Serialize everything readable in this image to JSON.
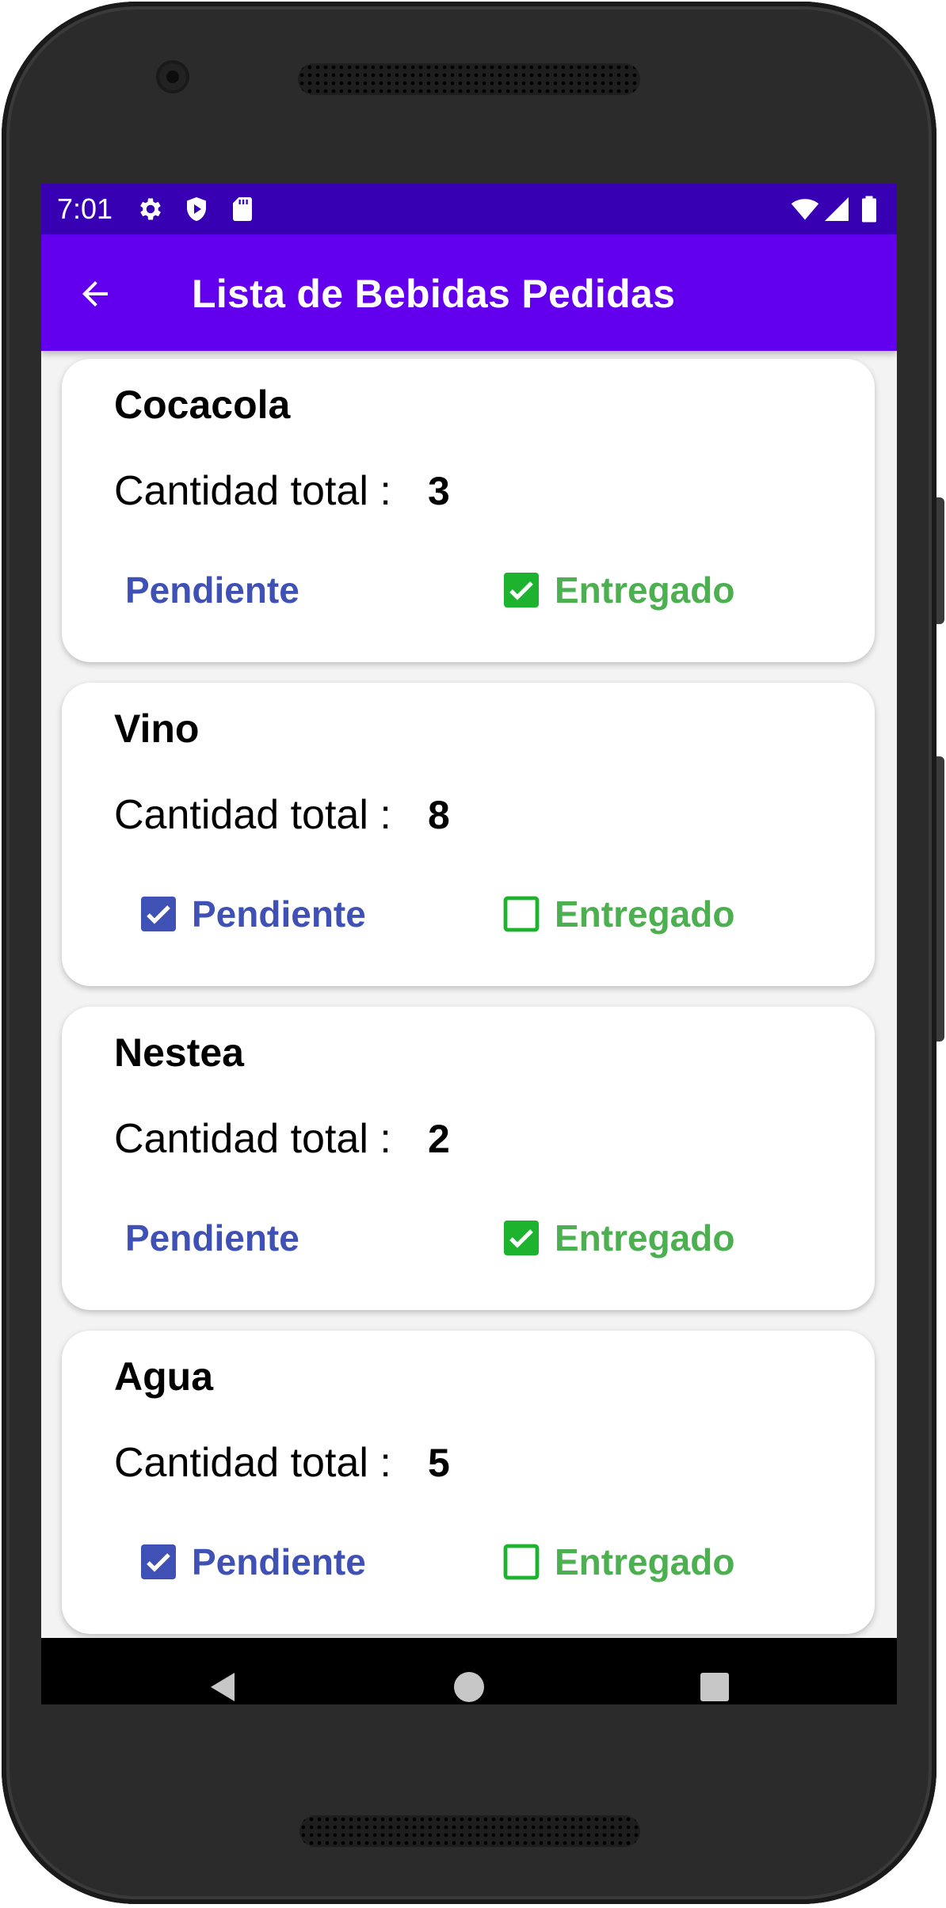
{
  "status_bar": {
    "time": "7:01",
    "left_icons": [
      "gear-icon",
      "shield-play-icon",
      "sd-card-icon"
    ],
    "right_icons": [
      "wifi-icon",
      "signal-icon",
      "battery-icon"
    ]
  },
  "app_bar": {
    "title": "Lista de Bebidas Pedidas",
    "back_icon": "arrow-left-icon"
  },
  "colors": {
    "status_bar": "#3700b3",
    "app_bar": "#6200ee",
    "pendiente": "#3f51b5",
    "entregado": "#4caf50"
  },
  "qty_label": "Cantidad total :",
  "orders": [
    {
      "name": "Cocacola",
      "quantity": "3",
      "pendiente": {
        "label": "Pendiente",
        "checked": false,
        "checkbox_visible": false
      },
      "entregado": {
        "label": "Entregado",
        "checked": true,
        "checkbox_visible": true
      }
    },
    {
      "name": "Vino",
      "quantity": "8",
      "pendiente": {
        "label": "Pendiente",
        "checked": true,
        "checkbox_visible": true
      },
      "entregado": {
        "label": "Entregado",
        "checked": false,
        "checkbox_visible": true
      }
    },
    {
      "name": "Nestea",
      "quantity": "2",
      "pendiente": {
        "label": "Pendiente",
        "checked": false,
        "checkbox_visible": false
      },
      "entregado": {
        "label": "Entregado",
        "checked": true,
        "checkbox_visible": true
      }
    },
    {
      "name": "Agua",
      "quantity": "5",
      "pendiente": {
        "label": "Pendiente",
        "checked": true,
        "checkbox_visible": true
      },
      "entregado": {
        "label": "Entregado",
        "checked": false,
        "checkbox_visible": true
      }
    }
  ],
  "nav_bar": {
    "buttons": [
      "back-triangle-icon",
      "home-circle-icon",
      "recents-square-icon"
    ]
  }
}
